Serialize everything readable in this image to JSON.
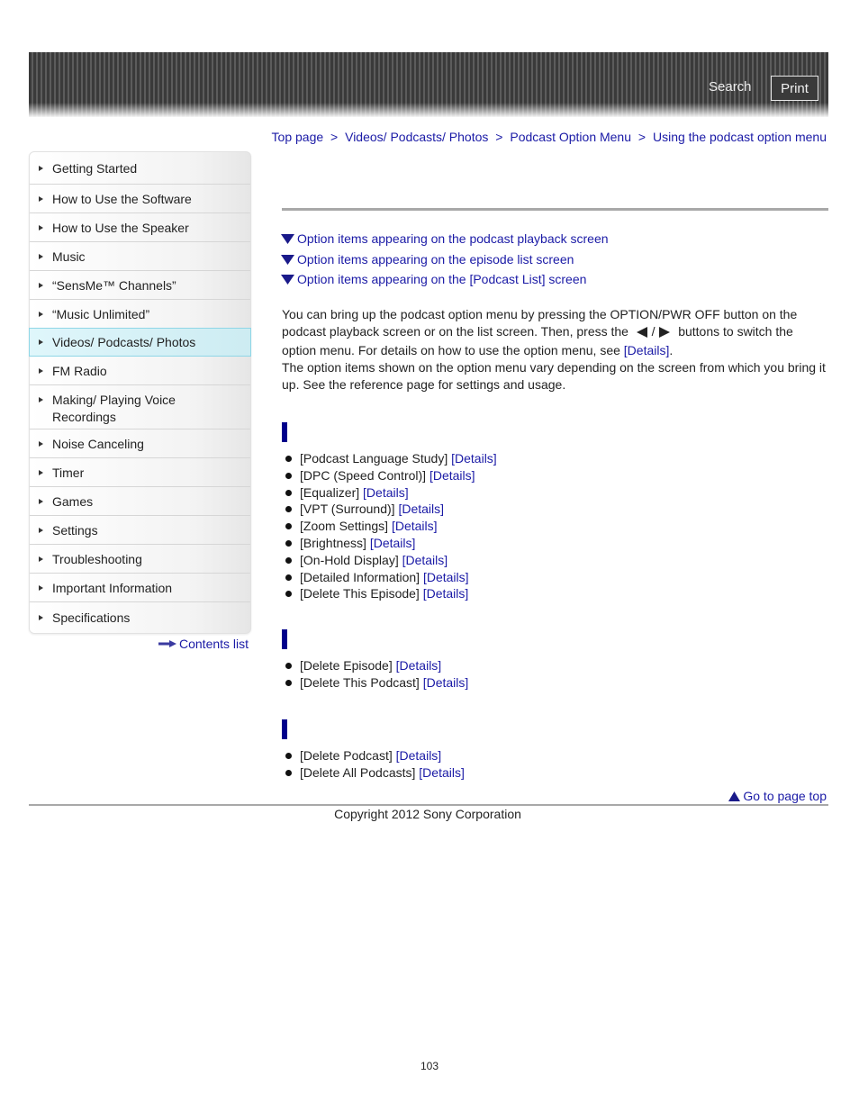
{
  "header": {
    "search_label": "Search",
    "print_label": "Print"
  },
  "breadcrumb": {
    "items": [
      "Top page",
      "Videos/ Podcasts/ Photos",
      "Podcast Option Menu",
      "Using the podcast option menu"
    ],
    "separator": ">"
  },
  "sidebar": {
    "items": [
      {
        "label": "Getting Started"
      },
      {
        "label": "How to Use the Software"
      },
      {
        "label": "How to Use the Speaker"
      },
      {
        "label": "Music"
      },
      {
        "label": "“SensMe™ Channels”"
      },
      {
        "label": "“Music Unlimited”"
      },
      {
        "label": "Videos/ Podcasts/ Photos",
        "active": true
      },
      {
        "label": "FM Radio"
      },
      {
        "label": "Making/ Playing Voice Recordings"
      },
      {
        "label": "Noise Canceling"
      },
      {
        "label": "Timer"
      },
      {
        "label": "Games"
      },
      {
        "label": "Settings"
      },
      {
        "label": "Troubleshooting"
      },
      {
        "label": "Important Information"
      },
      {
        "label": "Specifications"
      }
    ],
    "contents_list_label": "Contents list"
  },
  "toc": [
    "Option items appearing on the podcast playback screen",
    "Option items appearing on the episode list screen",
    "Option items appearing on the [Podcast List] screen"
  ],
  "intro": {
    "line1": "You can bring up the podcast option menu by pressing the OPTION/PWR OFF button on the",
    "line2_before": "podcast playback screen or on the list screen. Then, press the",
    "line2_sep": "/",
    "line2_after": "buttons to switch the",
    "line3_before": "option menu. For details on how to use the option menu, see",
    "line3_link": "[Details]",
    "line3_after": ".",
    "paragraph2": "The option items shown on the option menu vary depending on the screen from which you bring it up. See the reference page for settings and usage."
  },
  "sections": [
    {
      "items": [
        {
          "label": "[Podcast Language Study]",
          "link": "[Details]"
        },
        {
          "label": "[DPC (Speed Control)]",
          "link": "[Details]"
        },
        {
          "label": "[Equalizer]",
          "link": "[Details]"
        },
        {
          "label": "[VPT (Surround)]",
          "link": "[Details]"
        },
        {
          "label": "[Zoom Settings]",
          "link": "[Details]"
        },
        {
          "label": "[Brightness]",
          "link": "[Details]"
        },
        {
          "label": "[On-Hold Display]",
          "link": "[Details]"
        },
        {
          "label": "[Detailed Information]",
          "link": "[Details]"
        },
        {
          "label": "[Delete This Episode]",
          "link": "[Details]"
        }
      ]
    },
    {
      "items": [
        {
          "label": "[Delete Episode]",
          "link": "[Details]"
        },
        {
          "label": "[Delete This Podcast]",
          "link": "[Details]"
        }
      ]
    },
    {
      "items": [
        {
          "label": "[Delete Podcast]",
          "link": "[Details]"
        },
        {
          "label": "[Delete All Podcasts]",
          "link": "[Details]"
        }
      ]
    }
  ],
  "footer": {
    "go_to_top_label": "Go to page top",
    "copyright": "Copyright 2012 Sony Corporation",
    "page_number": "103"
  },
  "colors": {
    "link": "#1a1aa6",
    "section_bar": "#00008b",
    "active_nav_bg": "#dff6fb"
  }
}
